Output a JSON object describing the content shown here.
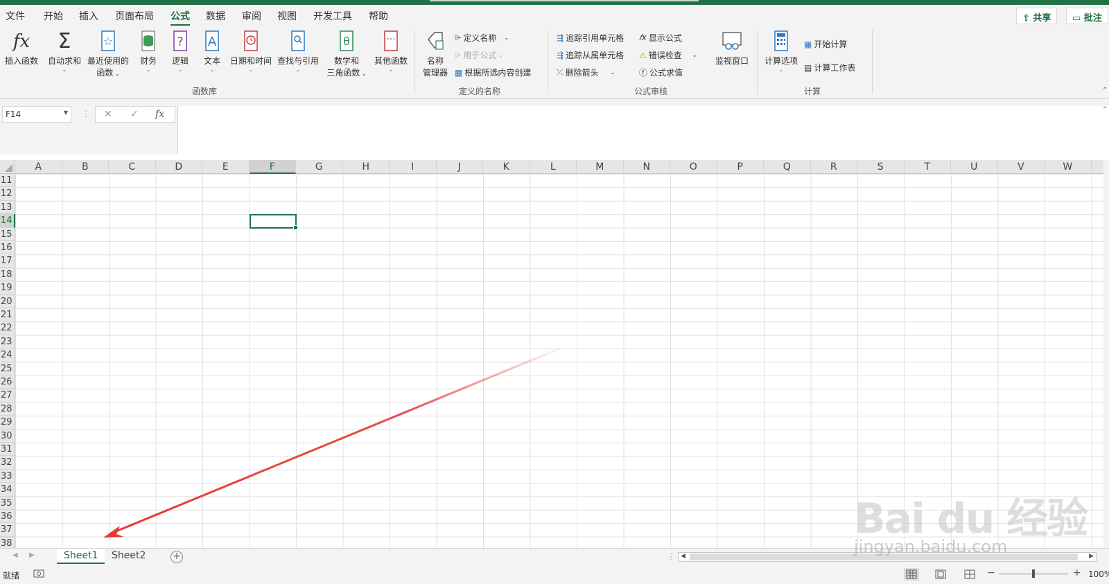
{
  "app": {
    "accent": "#217346"
  },
  "menubar": {
    "items": [
      "文件",
      "开始",
      "插入",
      "页面布局",
      "公式",
      "数据",
      "审阅",
      "视图",
      "开发工具",
      "帮助"
    ],
    "active": "公式",
    "share_label": "共享",
    "comment_label": "批注"
  },
  "ribbon": {
    "function_library": {
      "group_label": "函数库",
      "insert_function": "插入函数",
      "autosum": "自动求和",
      "recent_line1": "最近使用的",
      "recent_line2": "函数",
      "financial": "财务",
      "logical": "逻辑",
      "text": "文本",
      "datetime": "日期和时间",
      "lookup": "查找与引用",
      "math_line1": "数学和",
      "math_line2": "三角函数",
      "more": "其他函数",
      "fx_glyph": "fx",
      "sigma_glyph": "Σ"
    },
    "defined_names": {
      "group_label": "定义的名称",
      "manager_line1": "名称",
      "manager_line2": "管理器",
      "define_name": "定义名称",
      "use_in_formula": "用于公式",
      "create_from_selection": "根据所选内容创建"
    },
    "formula_auditing": {
      "group_label": "公式审核",
      "trace_precedents": "追踪引用单元格",
      "trace_dependents": "追踪从属单元格",
      "remove_arrows": "删除箭头",
      "show_formulas": "显示公式",
      "error_checking": "错误检查",
      "evaluate_formula": "公式求值",
      "watch_window": "监视窗口"
    },
    "calculation": {
      "group_label": "计算",
      "calc_options": "计算选项",
      "calc_now": "开始计算",
      "calc_sheet": "计算工作表"
    }
  },
  "formula_bar": {
    "name_box": "F14",
    "cancel_glyph": "✕",
    "enter_glyph": "✓",
    "fx_glyph": "fx",
    "content": ""
  },
  "grid": {
    "columns": [
      "A",
      "B",
      "C",
      "D",
      "E",
      "F",
      "G",
      "H",
      "I",
      "J",
      "K",
      "L",
      "M",
      "N",
      "O",
      "P",
      "Q",
      "R",
      "S",
      "T",
      "U",
      "V",
      "W"
    ],
    "rows": [
      "11",
      "12",
      "13",
      "14",
      "15",
      "16",
      "17",
      "18",
      "19",
      "20",
      "21",
      "22",
      "23",
      "24",
      "25",
      "26",
      "27",
      "28",
      "29",
      "30",
      "31",
      "32",
      "33",
      "34",
      "35",
      "36",
      "37",
      "38"
    ],
    "selected_column": "F",
    "selected_row": "14"
  },
  "sheets": {
    "tabs": [
      "Sheet1",
      "Sheet2"
    ],
    "active": "Sheet1",
    "add_glyph": "+"
  },
  "status": {
    "ready": "就绪",
    "zoom": "100%"
  },
  "watermark": {
    "brand": "Bai du 经验",
    "url": "jingyan.baidu.com"
  }
}
